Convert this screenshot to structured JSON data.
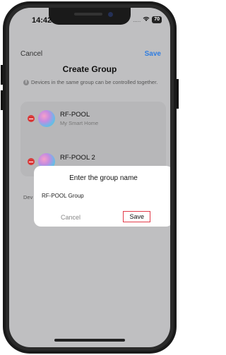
{
  "status_bar": {
    "time": "14:42",
    "signal": ".....",
    "wifi_icon": "wifi-icon",
    "battery": "70"
  },
  "nav": {
    "cancel": "Cancel",
    "save": "Save"
  },
  "title": "Create Group",
  "info": {
    "icon": "info-icon",
    "text": "Devices in the same group can be controlled together."
  },
  "devices": [
    {
      "name": "RF-POOL",
      "subtitle": "My Smart Home"
    },
    {
      "name": "RF-POOL 2",
      "subtitle": ""
    }
  ],
  "side_label": "Dev",
  "dialog": {
    "title": "Enter the group name",
    "value": "RF-POOL Group",
    "cancel": "Cancel",
    "save": "Save"
  },
  "colors": {
    "accent": "#2f7de1",
    "remove": "#d93a3a",
    "highlight": "#e23b4a"
  }
}
